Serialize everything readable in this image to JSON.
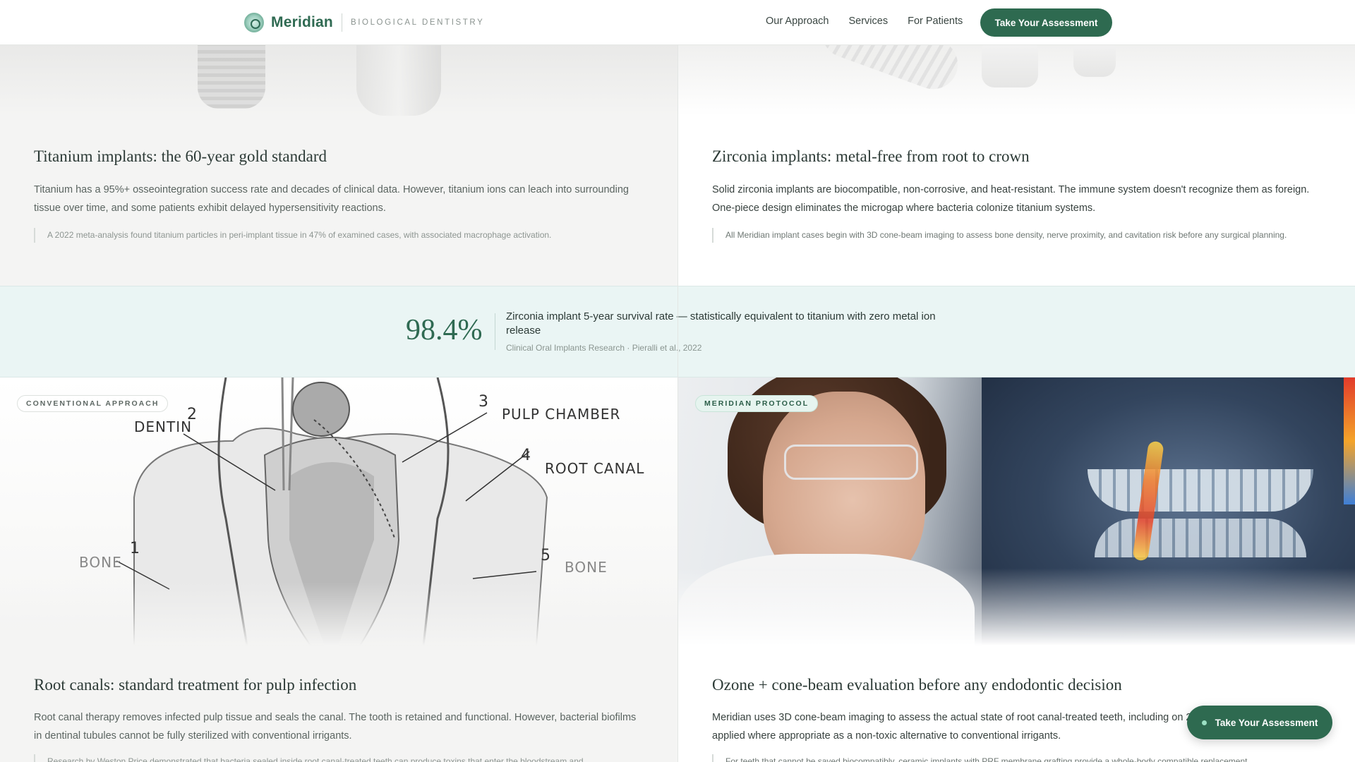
{
  "nav": {
    "brand": "Meridian",
    "tagline": "BIOLOGICAL DENTISTRY",
    "links": [
      "Our Approach",
      "Services",
      "For Patients"
    ],
    "cta": "Take Your Assessment"
  },
  "titanium": {
    "title": "Titanium implants: the 60-year gold standard",
    "body": "Titanium has a 95%+ osseointegration success rate and decades of clinical data. However, titanium ions can leach into surrounding tissue over time, and some patients exhibit delayed hypersensitivity reactions.",
    "quote": "A 2022 meta-analysis found titanium particles in peri-implant tissue in 47% of examined cases, with associated macrophage activation."
  },
  "zirconia": {
    "title": "Zirconia implants: metal-free from root to crown",
    "body": "Solid zirconia implants are biocompatible, non-corrosive, and heat-resistant. The immune system doesn't recognize them as foreign. One-piece design eliminates the microgap where bacteria colonize titanium systems.",
    "quote": "All Meridian implant cases begin with 3D cone-beam imaging to assess bone density, nerve proximity, and cavitation risk before any surgical planning."
  },
  "stat": {
    "value": "98.4%",
    "text": "Zirconia implant 5-year survival rate — statistically equivalent to titanium with zero metal ion release",
    "source": "Clinical Oral Implants Research · Pieralli et al., 2022"
  },
  "root_canal": {
    "pill": "CONVENTIONAL APPROACH",
    "diagram": {
      "labels": [
        "DENTIN",
        "PULP CHAMBER",
        "ROOT CANAL",
        "BONE",
        "BONE"
      ],
      "numbers": [
        "2",
        "3",
        "4",
        "1",
        "5"
      ]
    },
    "title": "Root canals: standard treatment for pulp infection",
    "body": "Root canal therapy removes infected pulp tissue and seals the canal. The tooth is retained and functional. However, bacterial biofilms in dentinal tubules cannot be fully sterilized with conventional irrigants.",
    "quote": "Research by Weston Price demonstrated that bacteria sealed inside root canal-treated teeth can produce toxins that enter the bloodstream and"
  },
  "ozone": {
    "pill": "MERIDIAN PROTOCOL",
    "title": "Ozone + cone-beam evaluation before any endodontic decision",
    "body": "Meridian uses 3D cone-beam imaging to assess the actual state of root canal-treated teeth, including on 2D X-rays. Ozone therapy is applied where appropriate as a non-toxic alternative to conventional irrigants.",
    "quote": "For teeth that cannot be saved biocompatibly, ceramic implants with PRF membrane grafting provide a whole-body compatible replacement."
  },
  "floating_cta": "Take Your Assessment",
  "colors": {
    "brand": "#2e6a50",
    "band": "#eaf5f4"
  }
}
